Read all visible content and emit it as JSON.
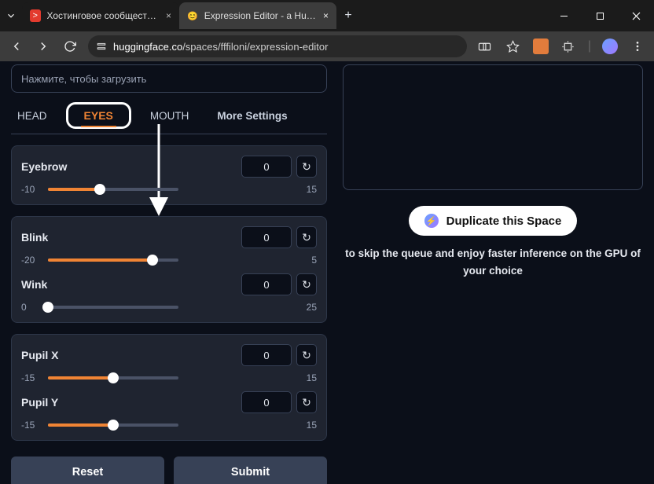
{
  "browser": {
    "tabs": [
      {
        "title": "Хостинговое сообщество «Tim",
        "favicon": ">",
        "favcolor": "#e33b2e"
      },
      {
        "title": "Expression Editor - a Hugging F",
        "favicon": "😊",
        "favcolor": "transparent"
      }
    ],
    "url_host": "huggingface.co",
    "url_path": "/spaces/fffiloni/expression-editor"
  },
  "upload_hint": "Нажмите, чтобы загрузить",
  "tabs": {
    "head": "HEAD",
    "eyes": "EYES",
    "mouth": "MOUTH",
    "more": "More Settings"
  },
  "sliders": {
    "eyebrow": {
      "label": "Eyebrow",
      "value": "0",
      "min": "-10",
      "max": "15",
      "pct": 40
    },
    "blink": {
      "label": "Blink",
      "value": "0",
      "min": "-20",
      "max": "5",
      "pct": 80
    },
    "wink": {
      "label": "Wink",
      "value": "0",
      "min": "0",
      "max": "25",
      "pct": 0
    },
    "pupilx": {
      "label": "Pupil X",
      "value": "0",
      "min": "-15",
      "max": "15",
      "pct": 50
    },
    "pupily": {
      "label": "Pupil Y",
      "value": "0",
      "min": "-15",
      "max": "15",
      "pct": 50
    }
  },
  "buttons": {
    "reset": "Reset",
    "submit": "Submit",
    "duplicate": "Duplicate this Space"
  },
  "helper": {
    "l1": "to skip the queue and enjoy faster inference on the GPU of",
    "l2": "your choice"
  }
}
